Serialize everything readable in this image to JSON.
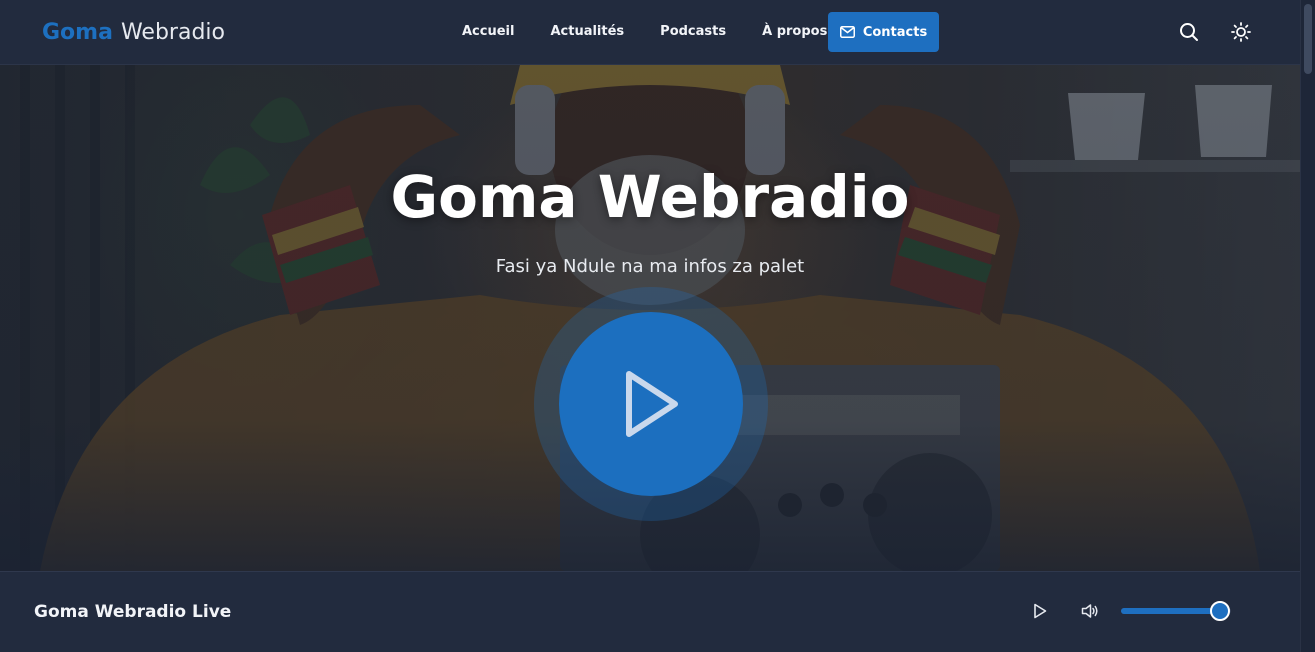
{
  "brand": {
    "part1": "Goma",
    "part2": "Webradio"
  },
  "nav": {
    "links": [
      {
        "label": "Accueil"
      },
      {
        "label": "Actualités"
      },
      {
        "label": "Podcasts"
      },
      {
        "label": "À propos"
      }
    ],
    "contact_label": "Contacts",
    "contact_icon": "mail-icon",
    "search_icon": "search-icon",
    "theme_icon": "sun-icon"
  },
  "hero": {
    "title": "Goma Webradio",
    "subtitle": "Fasi ya Ndule na ma infos za palet",
    "play_icon": "play-icon"
  },
  "player": {
    "title": "Goma Webradio Live",
    "play_icon": "play-icon",
    "volume_icon": "volume-icon",
    "volume_level": 0.9
  },
  "colors": {
    "accent": "#1e6fc0",
    "nav_bg": "#222b3e",
    "page_bg": "#1e2638"
  }
}
